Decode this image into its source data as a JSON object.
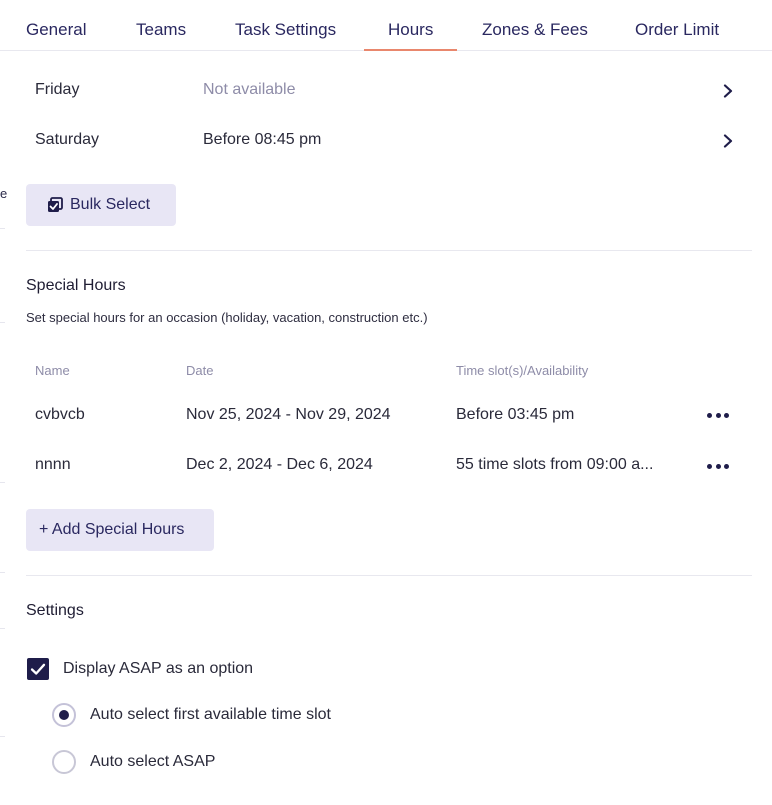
{
  "edge_fragment": "e",
  "tabs": [
    {
      "label": "General"
    },
    {
      "label": "Teams"
    },
    {
      "label": "Task Settings"
    },
    {
      "label": "Hours",
      "active": true
    },
    {
      "label": "Zones & Fees"
    },
    {
      "label": "Order Limit"
    }
  ],
  "weekly_hours": [
    {
      "day": "Friday",
      "value": "Not available",
      "available": false
    },
    {
      "day": "Saturday",
      "value": "Before 08:45 pm",
      "available": true
    }
  ],
  "bulk_select_label": "Bulk Select",
  "special_hours": {
    "title": "Special Hours",
    "description": "Set special hours for an occasion (holiday, vacation, construction etc.)",
    "columns": {
      "name": "Name",
      "date": "Date",
      "slots": "Time slot(s)/Availability"
    },
    "rows": [
      {
        "name": "cvbvcb",
        "date": "Nov 25, 2024 - Nov 29, 2024",
        "slots": "Before 03:45 pm"
      },
      {
        "name": "nnnn",
        "date": "Dec 2, 2024 - Dec 6, 2024",
        "slots": "55 time slots from 09:00 a..."
      }
    ],
    "add_label": "+ Add Special Hours"
  },
  "settings": {
    "title": "Settings",
    "asap_label": "Display ASAP as an option",
    "asap_checked": true,
    "options": [
      {
        "label": "Auto select first available time slot",
        "selected": true
      },
      {
        "label": "Auto select ASAP",
        "selected": false
      }
    ]
  },
  "colors": {
    "accent": "#e9876d",
    "primary": "#1f1d4a",
    "button_bg": "#e8e6f5",
    "muted": "#8e8ca8"
  }
}
